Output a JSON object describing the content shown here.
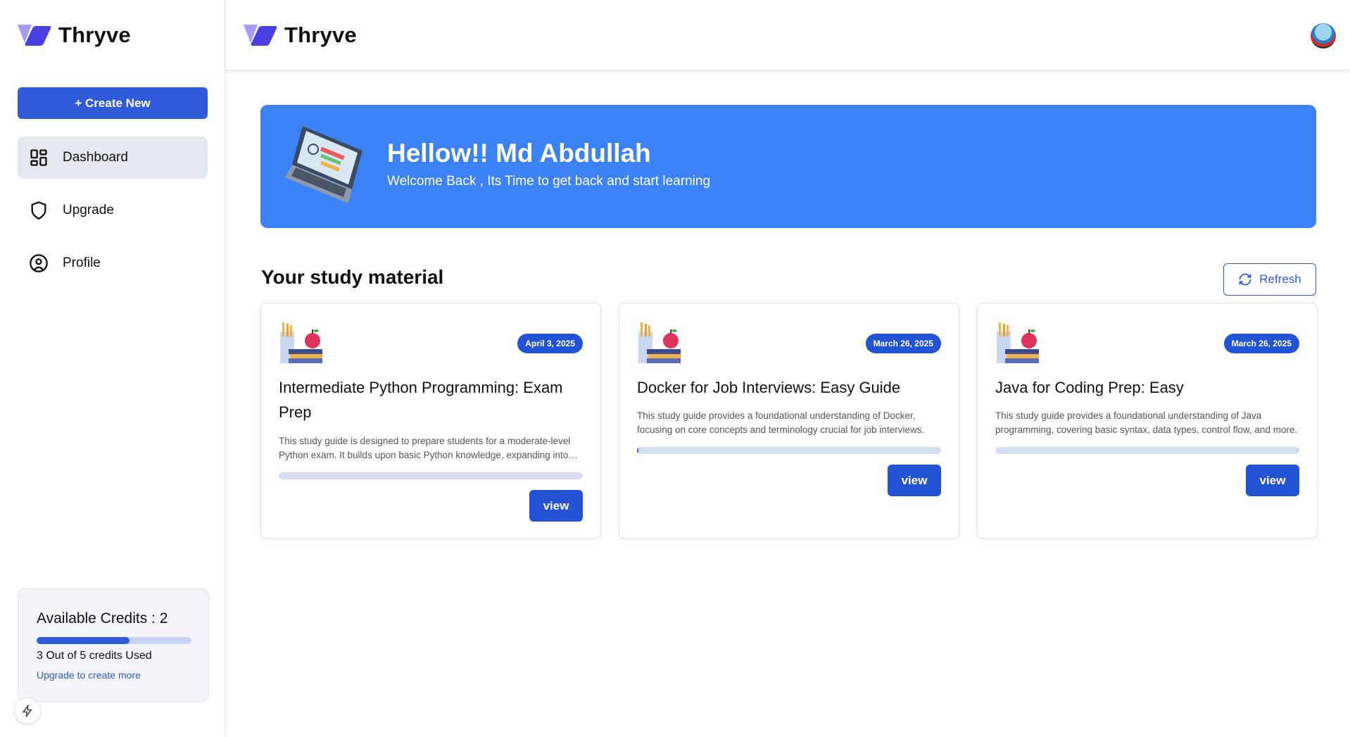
{
  "app": {
    "name": "Thryve"
  },
  "sidebar": {
    "create_label": "+ Create New",
    "items": [
      {
        "label": "Dashboard",
        "icon": "dashboard-icon",
        "active": true
      },
      {
        "label": "Upgrade",
        "icon": "shield-icon",
        "active": false
      },
      {
        "label": "Profile",
        "icon": "user-circle-icon",
        "active": false
      }
    ]
  },
  "credits": {
    "title": "Available Credits : 2",
    "used_text": "3 Out of 5 credits Used",
    "used_fraction": 0.6,
    "link": "Upgrade to create more"
  },
  "banner": {
    "title": "Hellow!! Md Abdullah",
    "subtitle": "Welcome Back , Its Time to get back and start learning"
  },
  "section": {
    "title": "Your study material",
    "refresh_label": "Refresh"
  },
  "cards": [
    {
      "date": "April 3, 2025",
      "title": "Intermediate Python Programming: Exam Prep",
      "description": "This study guide is designed to prepare students for a moderate-level Python exam. It builds upon basic Python knowledge, expanding into more advanced concepts.",
      "progress": 0,
      "view_label": "view"
    },
    {
      "date": "March 26, 2025",
      "title": "Docker for Job Interviews: Easy Guide",
      "description": "This study guide provides a foundational understanding of Docker, focusing on core concepts and terminology crucial for job interviews.",
      "progress": 0.005,
      "view_label": "view"
    },
    {
      "date": "March 26, 2025",
      "title": "Java for Coding Prep: Easy",
      "description": "This study guide provides a foundational understanding of Java programming, covering basic syntax, data types, control flow, and more.",
      "progress": 0,
      "view_label": "view"
    }
  ],
  "colors": {
    "primary": "#2f5bd9",
    "banner": "#3b82f6",
    "logo_light": "#a59cf5",
    "logo_dark": "#4a3fe3"
  }
}
